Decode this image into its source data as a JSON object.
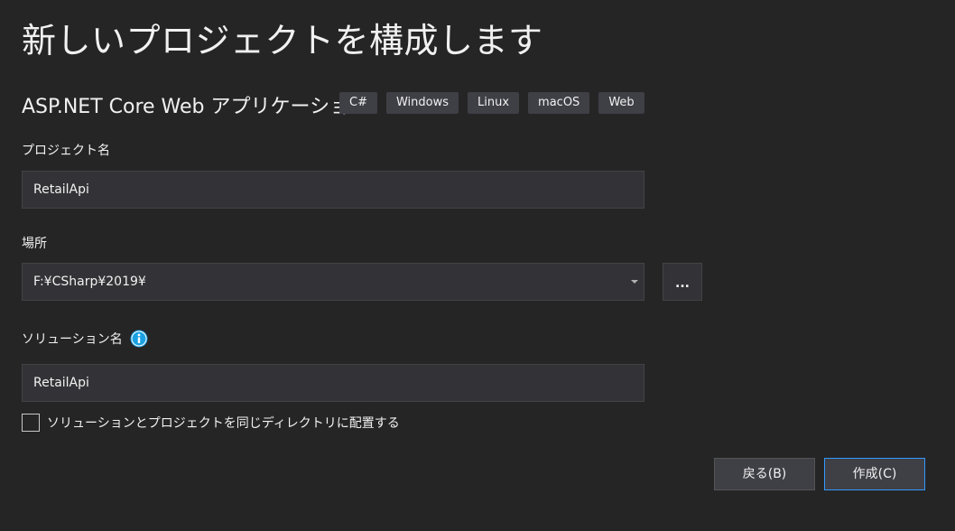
{
  "dialog": {
    "title": "新しいプロジェクトを構成します",
    "template_name": "ASP.NET Core Web アプリケーション",
    "tags": [
      "C#",
      "Windows",
      "Linux",
      "macOS",
      "Web"
    ]
  },
  "project_name": {
    "label": "プロジェクト名",
    "value": "RetailApi"
  },
  "location": {
    "label": "場所",
    "value": "F:¥CSharp¥2019¥",
    "browse_label": "..."
  },
  "solution_name": {
    "label": "ソリューション名",
    "value": "RetailApi",
    "info_icon": "info-icon"
  },
  "same_directory": {
    "label": "ソリューションとプロジェクトを同じディレクトリに配置する",
    "checked": false
  },
  "buttons": {
    "back_label": "戻る(B)",
    "create_label": "作成(C)"
  },
  "colors": {
    "background": "#252526",
    "field_background": "#333337",
    "tag_background": "#3f3f46",
    "accent": "#3399ff",
    "info_icon": "#1ba1e2"
  }
}
